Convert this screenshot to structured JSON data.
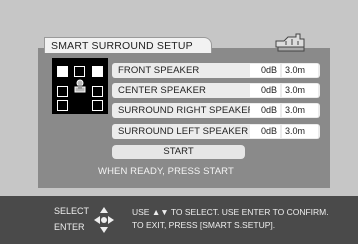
{
  "title": "SMART SURROUND SETUP",
  "speakers": [
    {
      "label": "FRONT SPEAKER",
      "level": "0dB",
      "distance": "3.0m"
    },
    {
      "label": "CENTER SPEAKER",
      "level": "0dB",
      "distance": "3.0m"
    },
    {
      "label": "SURROUND RIGHT SPEAKER",
      "level": "0dB",
      "distance": "3.0m"
    },
    {
      "label": "SURROUND LEFT SPEAKER",
      "level": "0dB",
      "distance": "3.0m"
    }
  ],
  "start_label": "START",
  "ready_text": "WHEN READY, PRESS START",
  "footer": {
    "select_label": "SELECT",
    "enter_label": "ENTER",
    "help_line1": "USE ▲▼ TO SELECT.  USE ENTER TO CONFIRM.",
    "help_line2": "TO EXIT, PRESS [SMART S.SETUP]."
  },
  "icons": {
    "header": "speaker-setup-icon",
    "listener": "listener-icon",
    "nav": "navigation-pad-icon"
  },
  "colors": {
    "panel": "#8a8a8a",
    "footer": "#4a4a4a",
    "row": "#ececec",
    "map": "#000000"
  }
}
